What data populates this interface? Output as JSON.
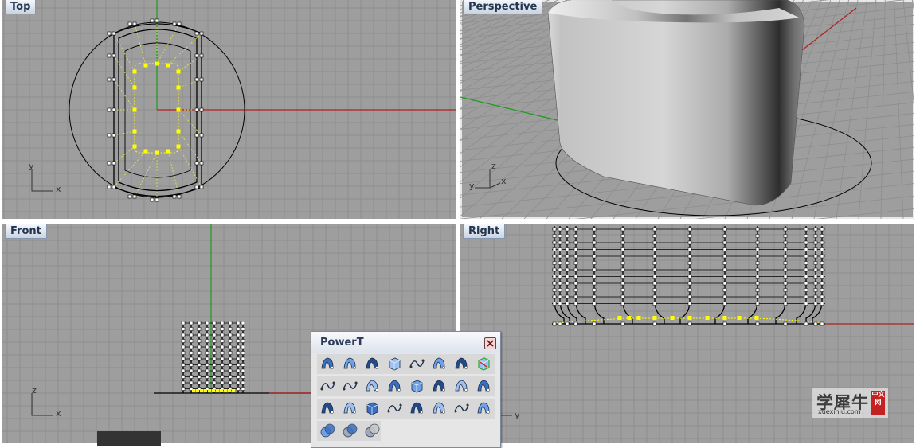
{
  "viewports": {
    "top": {
      "title": "Top",
      "axis_x": "x",
      "axis_y": "y"
    },
    "perspective": {
      "title": "Perspective",
      "axis_x": "x",
      "axis_y": "y",
      "axis_z": "z"
    },
    "front": {
      "title": "Front",
      "axis_x": "x",
      "axis_z": "z"
    },
    "right": {
      "title": "Right",
      "axis_y": "y"
    }
  },
  "toolbar": {
    "title": "PowerT",
    "rows": [
      [
        "rail-revolve-1-icon",
        "rail-revolve-2-icon",
        "flow-along-surface-icon",
        "extrude-surface-icon",
        "blend-surface-icon",
        "point-grid-icon",
        "mirror-icon",
        "box-edit-icon"
      ],
      [
        "curve-on-surface-icon",
        "polyline-icon",
        "plane-project-icon",
        "surface-plane-icon",
        "solid-box-icon",
        "split-mirror-icon",
        "bend-surface-icon",
        "diamond-icon"
      ],
      [
        "stack-points-icon",
        "offset-surface-icon",
        "cylinder-measure-icon",
        "line-cut-icon",
        "twist-icon",
        "rectangle-corner-icon",
        "curve-blend-icon",
        "funnel-icon"
      ],
      [
        "boolean-union-icon",
        "boolean-difference-icon",
        "boolean-intersect-icon"
      ]
    ]
  },
  "watermark": {
    "main": "学犀牛",
    "sub": "xuexiniu.com",
    "badge": "中文网"
  },
  "colors": {
    "viewport_bg": "#9e9e9e",
    "grid": "#8c8c8c",
    "x_axis": "#b0201c",
    "y_axis": "#1e9a1e",
    "points": "#ffff00",
    "curves": "#000000"
  }
}
